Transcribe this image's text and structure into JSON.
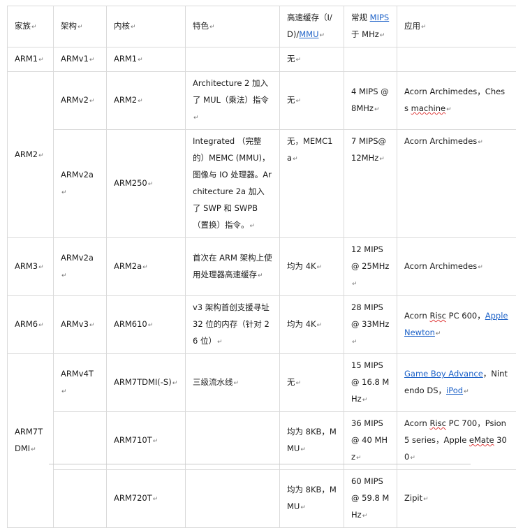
{
  "table": {
    "headers": {
      "family": "家族",
      "arch": "架构",
      "core": "内核",
      "feature": "特色",
      "cache_prefix": "高速缓存（I/D)/",
      "cache_link": "MMU",
      "mips_prefix": "常规 ",
      "mips_link": "MIPS",
      "mips_suffix": "于 MHz",
      "app": "应用"
    },
    "rows": {
      "arm1": {
        "family": "ARM1",
        "arch": "ARMv1",
        "core": "ARM1",
        "cache": "无"
      },
      "arm2": {
        "family": "ARM2",
        "r1": {
          "arch": "ARMv2",
          "core": "ARM2",
          "feature": "Architecture 2 加入了 MUL（乘法）指令",
          "cache": "无",
          "mips": "4 MIPS @ 8MHz",
          "app_text": "Acorn Archimedes，Chess ",
          "app_sq": "machine"
        },
        "r2": {
          "arch": "ARMv2a",
          "core": "ARM250",
          "feature": "Integrated （完整的）MEMC (MMU)，图像与 IO 处理器。Architecture 2a 加入了 SWP 和 SWPB（置换）指令。",
          "cache": "无，MEMC1a",
          "mips": "7 MIPS@ 12MHz",
          "app": "Acorn Archimedes"
        }
      },
      "arm3": {
        "family": "ARM3",
        "arch": "ARMv2a",
        "core": "ARM2a",
        "feature": "首次在 ARM 架构上使用处理器高速缓存",
        "cache": "均为 4K",
        "mips": "12 MIPS @ 25MHz",
        "app": "Acorn Archimedes"
      },
      "arm6": {
        "family": "ARM6",
        "arch": "ARMv3",
        "core": "ARM610",
        "feature": "v3 架构首创支援寻址 32 位的内存（针对 26 位）",
        "cache": "均为 4K",
        "mips": "28 MIPS @ 33MHz",
        "app_a": "Acorn ",
        "app_sq": "Risc",
        "app_b": " PC 600，",
        "app_link": "Apple Newton"
      },
      "arm7tdmi": {
        "family": "ARM7TDMI",
        "r1": {
          "arch": "ARMv4T",
          "core": "ARM7TDMI(-S)",
          "feature": "三级流水线",
          "cache": "无",
          "mips": "15 MIPS @ 16.8 MHz",
          "app_link1": "Game Boy Advance",
          "app_mid": "，Nintendo DS，",
          "app_link2": "iPod"
        },
        "r2": {
          "core": "ARM710T",
          "cache": "均为 8KB，MMU",
          "mips": "36 MIPS @ 40 MHz",
          "app_a": "Acorn ",
          "app_sq1": "Risc",
          "app_b": " PC 700，Psion 5 series，Apple ",
          "app_sq2": "eMate",
          "app_c": " 300"
        },
        "r3": {
          "core": "ARM720T",
          "cache": "均为 8KB，MMU",
          "mips": "60 MIPS @ 59.8 MHz",
          "app": "Zipit"
        }
      }
    }
  }
}
